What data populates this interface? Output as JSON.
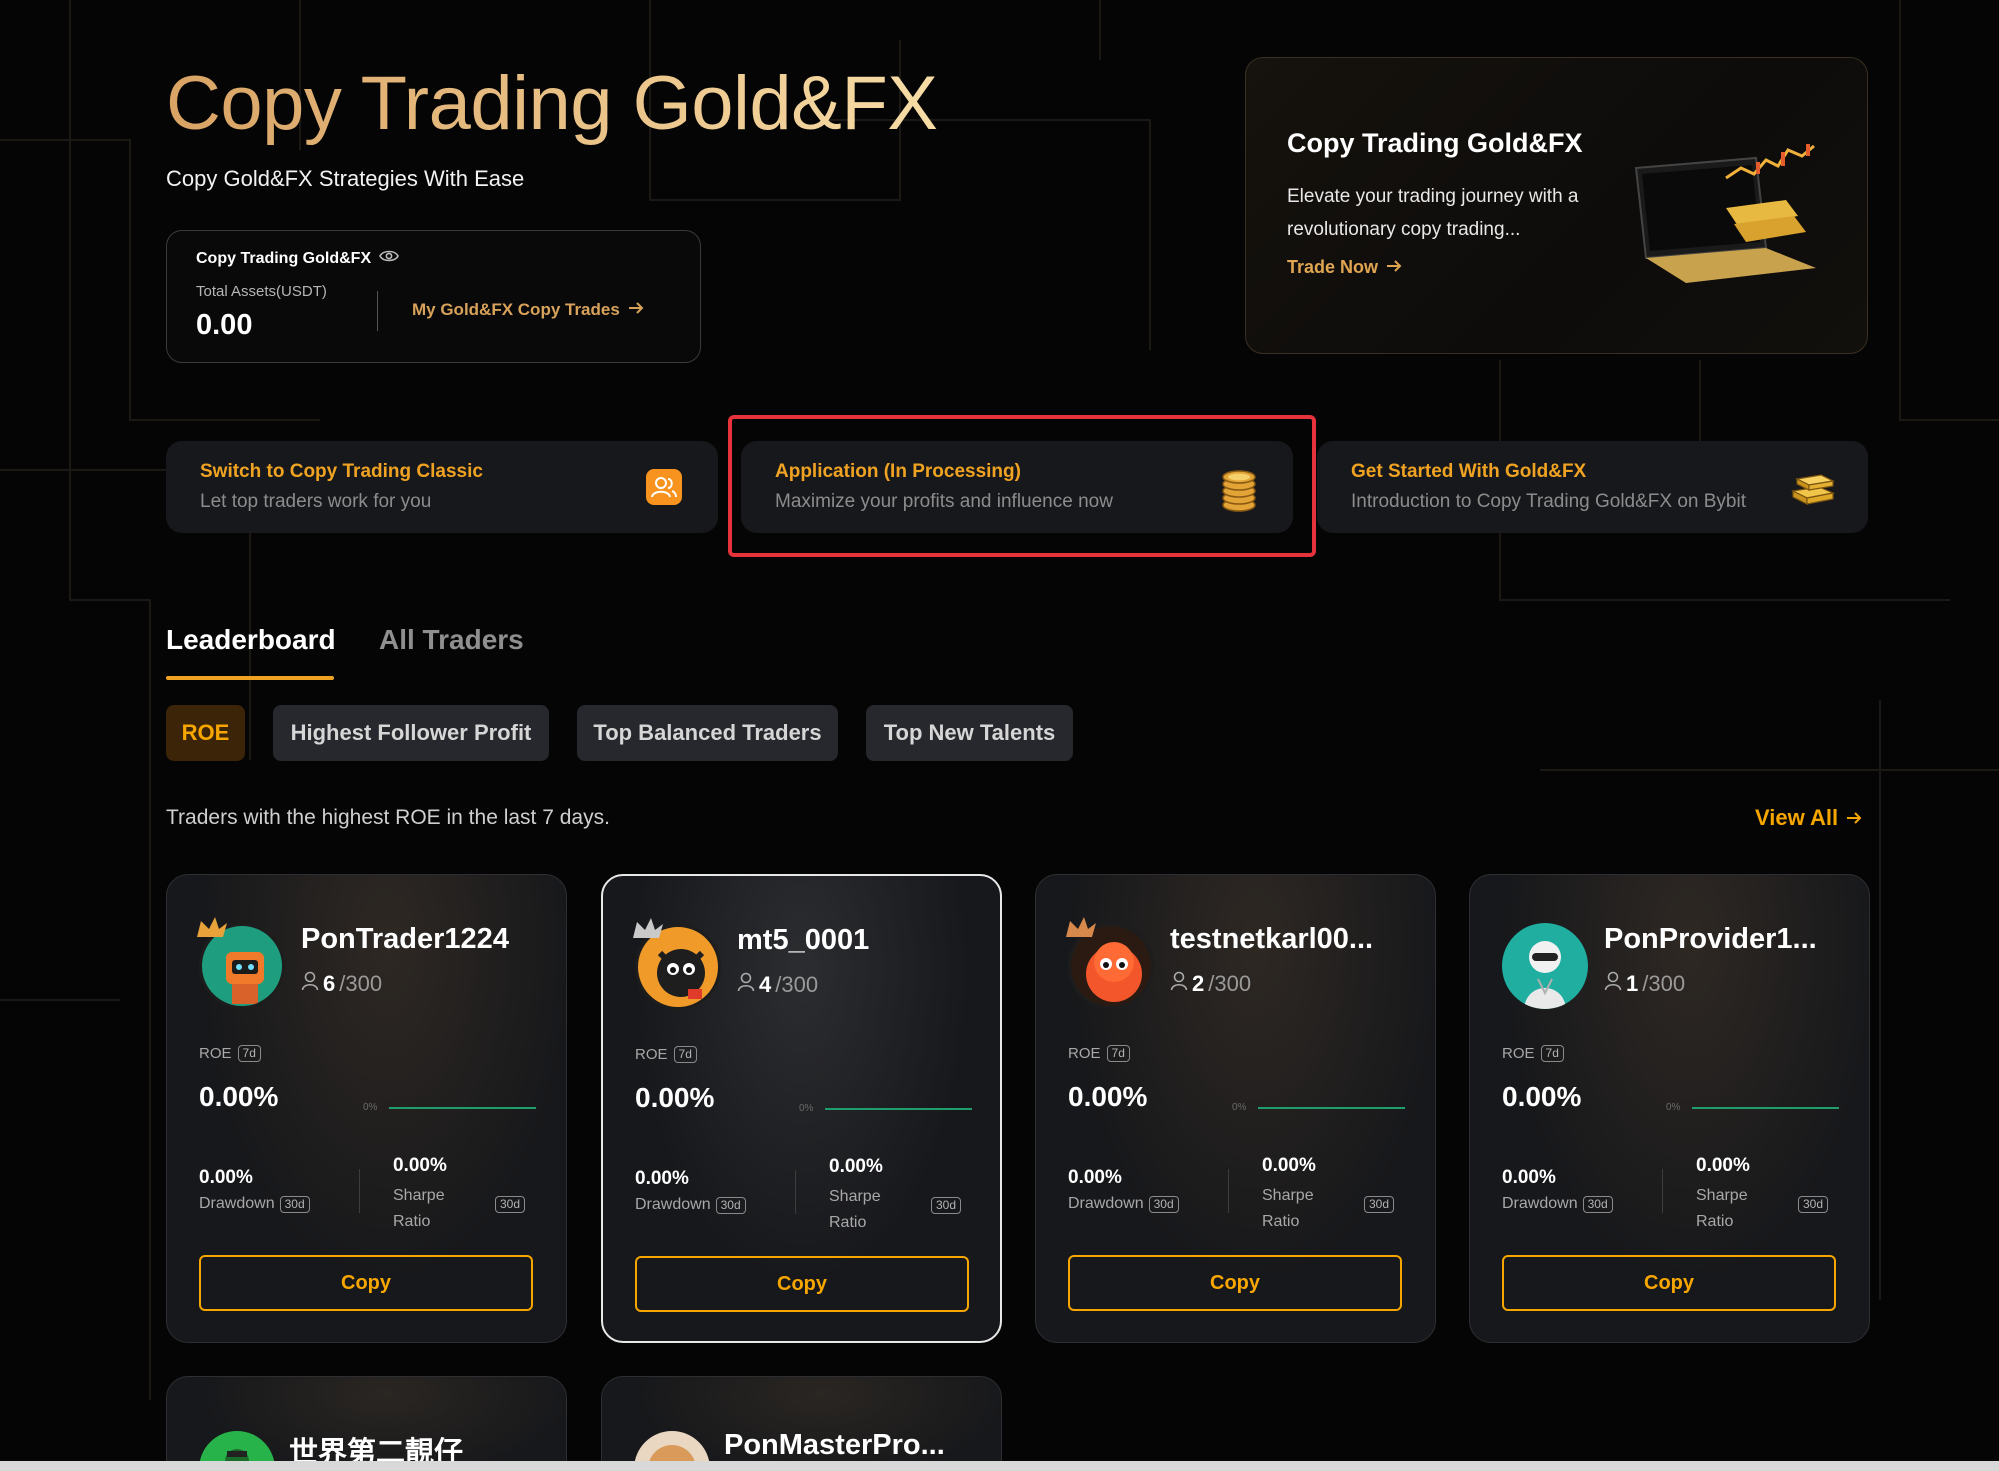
{
  "hero": {
    "title": "Copy Trading Gold&FX",
    "subtitle": "Copy Gold&FX Strategies With Ease"
  },
  "assets": {
    "title": "Copy Trading Gold&FX",
    "label": "Total Assets(USDT)",
    "value": "0.00",
    "link": "My Gold&FX Copy Trades"
  },
  "promo": {
    "title": "Copy Trading Gold&FX",
    "description": "Elevate your trading journey with a revolutionary copy trading...",
    "link": "Trade Now"
  },
  "features": [
    {
      "title": "Switch to Copy Trading Classic",
      "subtitle": "Let top traders work for you",
      "icon": "users-icon"
    },
    {
      "title": "Application (In Processing)",
      "subtitle": "Maximize your profits and influence now",
      "icon": "coin-stack-icon"
    },
    {
      "title": "Get Started With Gold&FX",
      "subtitle": "Introduction to Copy Trading Gold&FX on Bybit",
      "icon": "gold-bars-icon"
    }
  ],
  "tabs": [
    "Leaderboard",
    "All Traders"
  ],
  "chips": [
    "ROE",
    "Highest Follower Profit",
    "Top Balanced Traders",
    "Top New Talents"
  ],
  "leaderboard": {
    "description": "Traders with the highest ROE in the last 7 days.",
    "view_all": "View All"
  },
  "card_labels": {
    "roe": "ROE",
    "roe_period": "7d",
    "zero": "0%",
    "drawdown": "Drawdown",
    "sharpe_line1": "Sharpe",
    "sharpe_line2": "Ratio",
    "period_30d": "30d",
    "copy": "Copy"
  },
  "traders": [
    {
      "name": "PonTrader1224",
      "followers": "6",
      "max": "/300",
      "roe": "0.00%",
      "drawdown": "0.00%",
      "sharpe": "0.00%"
    },
    {
      "name": "mt5_0001",
      "followers": "4",
      "max": "/300",
      "roe": "0.00%",
      "drawdown": "0.00%",
      "sharpe": "0.00%"
    },
    {
      "name": "testnetkarl00...",
      "followers": "2",
      "max": "/300",
      "roe": "0.00%",
      "drawdown": "0.00%",
      "sharpe": "0.00%"
    },
    {
      "name": "PonProvider1...",
      "followers": "1",
      "max": "/300",
      "roe": "0.00%",
      "drawdown": "0.00%",
      "sharpe": "0.00%"
    }
  ],
  "traders_row2": [
    {
      "name": "世界第二靚仔"
    },
    {
      "name": "PonMasterPro..."
    }
  ],
  "colors": {
    "accent": "#f7a600",
    "gold": "#d8a25a",
    "highlight": "#e6323b",
    "spark": "#1f9d6c"
  }
}
